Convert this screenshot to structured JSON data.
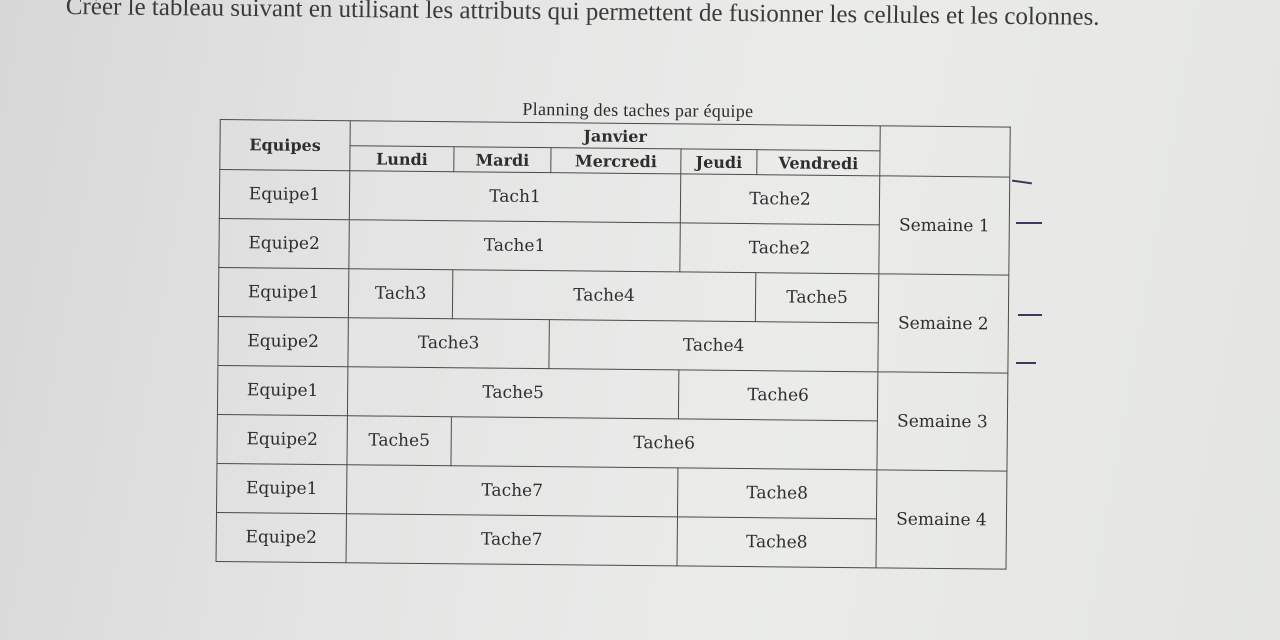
{
  "instruction": "Créer le tableau suivant en utilisant les attributs qui permettent de fusionner les cellules et les colonnes.",
  "table": {
    "caption": "Planning des taches par équipe",
    "header": {
      "equipes": "Equipes",
      "month": "Janvier",
      "days": [
        "Lundi",
        "Mardi",
        "Mercredi",
        "Jeudi",
        "Vendredi"
      ]
    },
    "rows": [
      {
        "team": "Equipe1",
        "cells": [
          "Tach1",
          "Tache2"
        ],
        "week": "Semaine 1"
      },
      {
        "team": "Equipe2",
        "cells": [
          "Tache1",
          "Tache2"
        ]
      },
      {
        "team": "Equipe1",
        "cells": [
          "Tach3",
          "Tache4",
          "Tache5"
        ],
        "week": "Semaine 2"
      },
      {
        "team": "Equipe2",
        "cells": [
          "Tache3",
          "Tache4"
        ]
      },
      {
        "team": "Equipe1",
        "cells": [
          "Tache5",
          "Tache6"
        ],
        "week": "Semaine 3"
      },
      {
        "team": "Equipe2",
        "cells": [
          "Tache5",
          "Tache6"
        ]
      },
      {
        "team": "Equipe1",
        "cells": [
          "Tache7",
          "Tache8"
        ],
        "week": "Semaine 4"
      },
      {
        "team": "Equipe2",
        "cells": [
          "Tache7",
          "Tache8"
        ]
      }
    ]
  }
}
